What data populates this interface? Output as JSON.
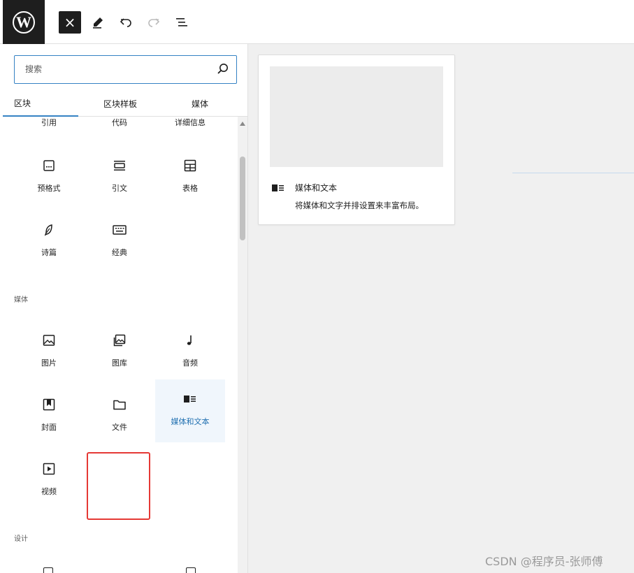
{
  "toolbar": {
    "logo_text": "W",
    "close_label": "×"
  },
  "search": {
    "placeholder": "搜索"
  },
  "tabs": [
    {
      "label": "区块",
      "active": true
    },
    {
      "label": "区块样板",
      "active": false
    },
    {
      "label": "媒体",
      "active": false
    }
  ],
  "text_blocks_partial": [
    {
      "label": "引用",
      "icon": "quote-icon"
    },
    {
      "label": "代码",
      "icon": "code-icon"
    },
    {
      "label": "详细信息",
      "icon": "details-icon"
    }
  ],
  "text_blocks": [
    {
      "label": "预格式",
      "icon": "preformatted-icon"
    },
    {
      "label": "引文",
      "icon": "pullquote-icon"
    },
    {
      "label": "表格",
      "icon": "table-icon"
    },
    {
      "label": "诗篇",
      "icon": "verse-icon"
    },
    {
      "label": "经典",
      "icon": "classic-icon"
    }
  ],
  "categories": {
    "media": "媒体",
    "design": "设计"
  },
  "media_blocks": [
    {
      "label": "图片",
      "icon": "image-icon"
    },
    {
      "label": "图库",
      "icon": "gallery-icon"
    },
    {
      "label": "音频",
      "icon": "audio-icon"
    },
    {
      "label": "封面",
      "icon": "cover-icon"
    },
    {
      "label": "文件",
      "icon": "file-icon"
    },
    {
      "label": "媒体和文本",
      "icon": "media-text-icon",
      "selected": true
    },
    {
      "label": "视频",
      "icon": "video-icon"
    }
  ],
  "preview": {
    "title": "媒体和文本",
    "description": "将媒体和文字并排设置来丰富布局。"
  },
  "watermark": "CSDN @程序员-张师傅",
  "colors": {
    "accent": "#3582c4",
    "highlight_bg": "#f0f6fc",
    "highlight_text": "#2271b1",
    "annotation_red": "#e53935",
    "dark": "#1e1e1e"
  }
}
